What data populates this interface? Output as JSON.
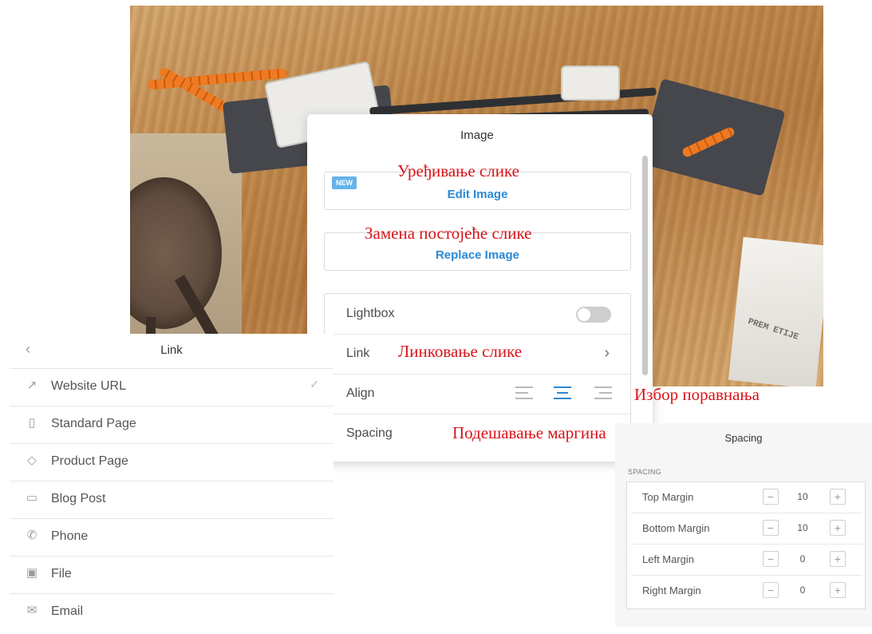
{
  "image_panel": {
    "title": "Image",
    "new_badge": "NEW",
    "edit_image": "Edit Image",
    "replace_image": "Replace Image",
    "rows": {
      "lightbox": "Lightbox",
      "link": "Link",
      "align": "Align",
      "spacing": "Spacing"
    },
    "lightbox_enabled": false,
    "align_selected": "center"
  },
  "link_panel": {
    "title": "Link",
    "items": [
      {
        "label": "Website URL",
        "icon": "external-link-icon",
        "selected": true
      },
      {
        "label": "Standard Page",
        "icon": "page-icon"
      },
      {
        "label": "Product Page",
        "icon": "tag-icon"
      },
      {
        "label": "Blog Post",
        "icon": "comment-icon"
      },
      {
        "label": "Phone",
        "icon": "phone-icon"
      },
      {
        "label": "File",
        "icon": "folder-icon"
      },
      {
        "label": "Email",
        "icon": "envelope-icon"
      }
    ]
  },
  "spacing_panel": {
    "title": "Spacing",
    "caption": "SPACING",
    "rows": [
      {
        "label": "Top Margin",
        "value": "10"
      },
      {
        "label": "Bottom Margin",
        "value": "10"
      },
      {
        "label": "Left Margin",
        "value": "0"
      },
      {
        "label": "Right Margin",
        "value": "0"
      }
    ],
    "minus": "−",
    "plus": "+"
  },
  "annotations": {
    "edit": "Уређивање слике",
    "replace": "Замена постојеће слике",
    "link": "Линковање слике",
    "align": "Избор поравнања",
    "spacing": "Подешавање маргина"
  },
  "photo_text": "PREM ETIJE"
}
